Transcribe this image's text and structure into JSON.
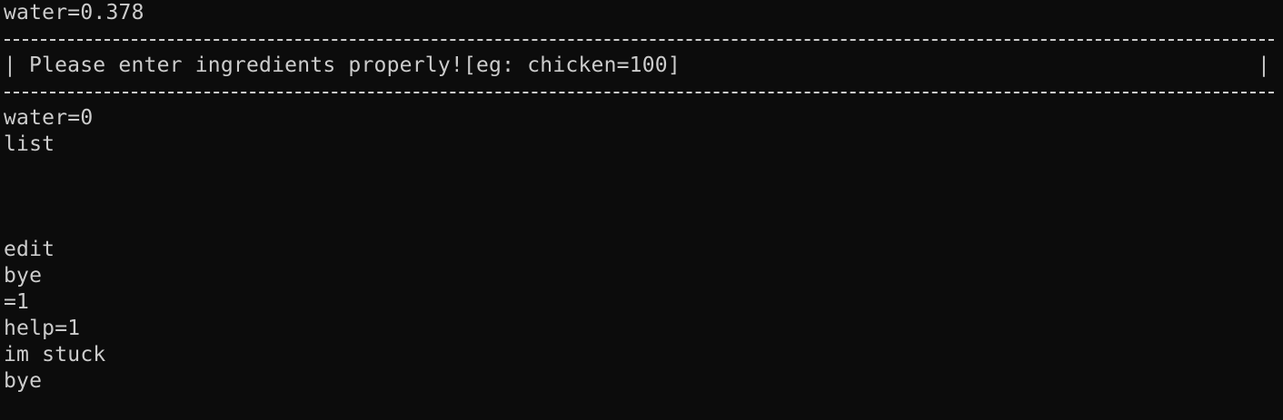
{
  "terminal": {
    "header_line": "water=0.378",
    "message_box": {
      "left_border": "|",
      "text": "Please enter ingredients properly![eg: chicken=100]",
      "right_border": "|"
    },
    "lines_after_box": [
      "water=0",
      "list"
    ],
    "lines_after_blank": [
      "edit",
      "bye",
      "=1",
      "help=1",
      "im stuck",
      "bye"
    ],
    "colors": {
      "background": "#0c0c0c",
      "text": "#cccccc"
    }
  }
}
